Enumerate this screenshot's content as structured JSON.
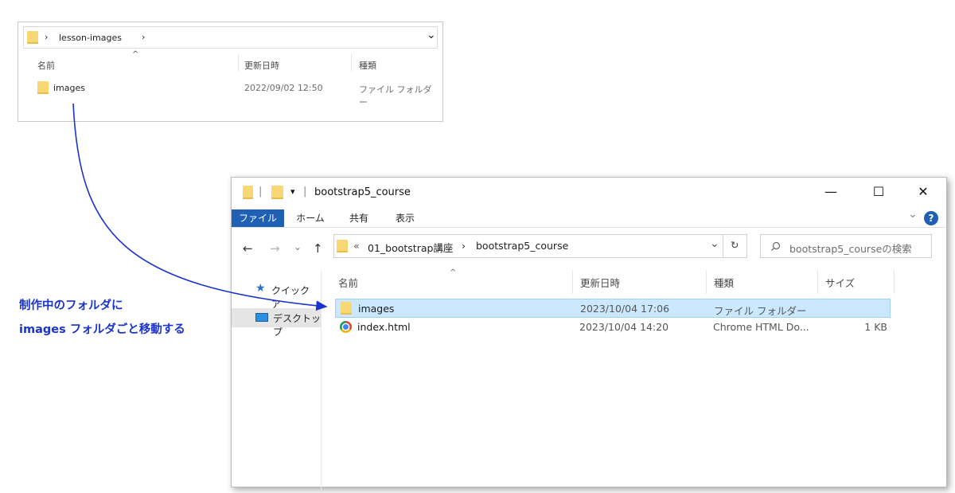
{
  "small_window": {
    "breadcrumb_sep": "›",
    "breadcrumb_folder": "lesson-images",
    "breadcrumb_sep2": "›",
    "dropdown_glyph": "⌄",
    "sort_glyph": "^",
    "columns": {
      "name": "名前",
      "modified": "更新日時",
      "type": "種類"
    },
    "rows": [
      {
        "name": "images",
        "modified": "2022/09/02 12:50",
        "type": "ファイル フォルダー",
        "icon": "folder-icon"
      }
    ]
  },
  "big_window": {
    "title": "bootstrap5_course",
    "title_sep": "|",
    "qa_dropdown": "▾",
    "controls": {
      "minimize": "—",
      "maximize": "☐",
      "close": "✕"
    },
    "ribbon_tabs": [
      "ファイル",
      "ホーム",
      "共有",
      "表示"
    ],
    "ribbon_expand": "⌄",
    "help": "?",
    "nav": {
      "back": "←",
      "forward": "→",
      "recent": "⌄",
      "up": "↑"
    },
    "address": {
      "overflow": "«",
      "parent": "01_bootstrap講座",
      "sep": "›",
      "current": "bootstrap5_course",
      "dropdown": "⌄",
      "refresh": "↻"
    },
    "search": {
      "icon": "search-icon",
      "placeholder": "bootstrap5_courseの検索"
    },
    "nav_pane": [
      {
        "label": "クイック ア",
        "icon": "star-icon"
      },
      {
        "label": "デスクトップ",
        "icon": "desktop-icon"
      }
    ],
    "sort_glyph": "^",
    "columns": {
      "name": "名前",
      "modified": "更新日時",
      "type": "種類",
      "size": "サイズ"
    },
    "rows": [
      {
        "name": "images",
        "modified": "2023/10/04 17:06",
        "type": "ファイル フォルダー",
        "size": "",
        "icon": "folder-icon",
        "selected": true
      },
      {
        "name": "index.html",
        "modified": "2023/10/04 14:20",
        "type": "Chrome HTML Do...",
        "size": "1 KB",
        "icon": "chrome-icon",
        "selected": false
      }
    ]
  },
  "annotation": {
    "line1": "制作中のフォルダに",
    "line2": "images フォルダごと移動する",
    "color": "#1a33cc"
  },
  "colors": {
    "ribbon_file_tab": "#1f5fb4",
    "selection": "#cce8ff",
    "folder": "#f8d775",
    "help": "#1f5fb4"
  }
}
